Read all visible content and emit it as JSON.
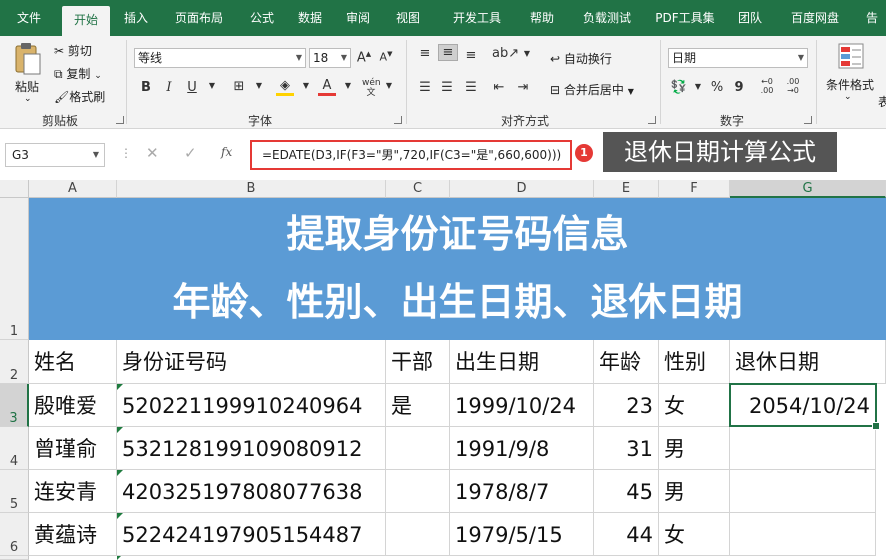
{
  "tabs": [
    "文件",
    "开始",
    "插入",
    "页面布局",
    "公式",
    "数据",
    "审阅",
    "视图",
    "开发工具",
    "帮助",
    "负载测试",
    "PDF工具集",
    "团队",
    "百度网盘",
    "告"
  ],
  "active_tab": "开始",
  "ribbon": {
    "clipboard": {
      "paste": "粘贴",
      "cut": "剪切",
      "copy": "复制",
      "format_painter": "格式刷",
      "label": "剪贴板"
    },
    "font": {
      "name": "等线",
      "size": "18",
      "bold": "B",
      "italic": "I",
      "underline": "U",
      "font_color": "A",
      "label": "字体"
    },
    "alignment": {
      "wrap": "自动换行",
      "merge": "合并后居中",
      "label": "对齐方式"
    },
    "number": {
      "format": "日期",
      "percent": "%",
      "comma": "9",
      "label": "数字"
    },
    "styles": {
      "conditional": "条件格式",
      "cut_off": "表"
    }
  },
  "formula_bar": {
    "name_box": "G3",
    "formula": "=EDATE(D3,IF(F3=\"男\",720,IF(C3=\"是\",660,600)))",
    "badge": "1",
    "annotation": "退休日期计算公式"
  },
  "columns": [
    "A",
    "B",
    "C",
    "D",
    "E",
    "F",
    "G"
  ],
  "selected_column": "G",
  "rows": [
    "1",
    "2",
    "3",
    "4",
    "5",
    "6"
  ],
  "selected_row": "3",
  "title": {
    "line1": "提取身份证号码信息",
    "line2": "年龄、性别、出生日期、退休日期"
  },
  "table": {
    "headers": [
      "姓名",
      "身份证号码",
      "干部",
      "出生日期",
      "年龄",
      "性别",
      "退休日期"
    ],
    "rows": [
      [
        "殷唯爱",
        "520221199910240964",
        "是",
        "1999/10/24",
        "23",
        "女",
        "2054/10/24"
      ],
      [
        "曾瑾俞",
        "532128199109080912",
        "",
        "1991/9/8",
        "31",
        "男",
        ""
      ],
      [
        "连安青",
        "420325197808077638",
        "",
        "1978/8/7",
        "45",
        "男",
        ""
      ],
      [
        "黄蕴诗",
        "522424197905154487",
        "",
        "1979/5/15",
        "44",
        "女",
        ""
      ]
    ]
  },
  "colors": {
    "accent": "#217346",
    "title_bg": "#5b9bd5",
    "highlight": "#e53935"
  }
}
